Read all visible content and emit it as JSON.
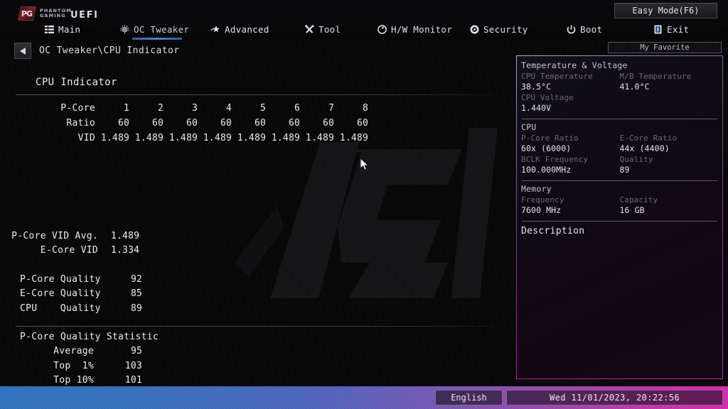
{
  "brand": {
    "badge": "PG",
    "line1": "PHANTOM",
    "line2": "GAMING",
    "uefi": "UEFI"
  },
  "topbar": {
    "easy_mode": "Easy Mode(F6)",
    "tabs": [
      {
        "label": "Main",
        "icon": "list-icon",
        "active": false
      },
      {
        "label": "OC Tweaker",
        "icon": "chip-icon",
        "active": true
      },
      {
        "label": "Advanced",
        "icon": "star-icon",
        "active": false
      },
      {
        "label": "Tool",
        "icon": "tools-icon",
        "active": false
      },
      {
        "label": "H/W Monitor",
        "icon": "gauge-icon",
        "active": false
      },
      {
        "label": "Security",
        "icon": "shield-icon",
        "active": false
      },
      {
        "label": "Boot",
        "icon": "power-icon",
        "active": false
      },
      {
        "label": "Exit",
        "icon": "exit-icon",
        "active": false
      }
    ]
  },
  "breadcrumb": {
    "back_icon": "back-arrow-icon",
    "path": "OC Tweaker\\CPU Indicator",
    "my_favorite": "My Favorite"
  },
  "main": {
    "title": "CPU Indicator",
    "core_table": {
      "row_labels": [
        "P-Core",
        "Ratio",
        "VID"
      ],
      "cores": [
        "1",
        "2",
        "3",
        "4",
        "5",
        "6",
        "7",
        "8"
      ],
      "ratio": [
        "60",
        "60",
        "60",
        "60",
        "60",
        "60",
        "60",
        "60"
      ],
      "vid": [
        "1.489",
        "1.489",
        "1.489",
        "1.489",
        "1.489",
        "1.489",
        "1.489",
        "1.489"
      ]
    },
    "vid_block": [
      {
        "label": "P-Core VID Avg.",
        "value": "1.489"
      },
      {
        "label": "E-Core VID",
        "value": "1.334"
      }
    ],
    "quality_block": [
      {
        "label": "P-Core Quality",
        "value": "92"
      },
      {
        "label": "E-Core Quality",
        "value": "85"
      },
      {
        "label": "CPU    Quality",
        "value": "89"
      }
    ],
    "statistic_block": {
      "heading": "P-Core Quality Statistic",
      "rows": [
        {
          "label": "Average",
          "value": "95"
        },
        {
          "label": "Top  1%",
          "value": "103"
        },
        {
          "label": "Top 10%",
          "value": "101"
        }
      ]
    }
  },
  "sidebar": {
    "sections": [
      {
        "title": "Temperature & Voltage",
        "pairs": [
          {
            "label": "CPU Temperature",
            "value": "38.5°C",
            "label2": "M/B Temperature",
            "value2": "41.0°C"
          },
          {
            "label": "CPU Voltage",
            "value": "1.440V",
            "label2": "",
            "value2": ""
          }
        ]
      },
      {
        "title": "CPU",
        "pairs": [
          {
            "label": "P-Core Ratio",
            "value": "60x (6000)",
            "label2": "E-Core Ratio",
            "value2": "44x (4400)"
          },
          {
            "label": "BCLK Frequency",
            "value": "100.000MHz",
            "label2": "Quality",
            "value2": "89"
          }
        ]
      },
      {
        "title": "Memory",
        "pairs": [
          {
            "label": "Frequency",
            "value": "7600 MHz",
            "label2": "Capacity",
            "value2": "16 GB"
          }
        ]
      }
    ],
    "description_title": "Description"
  },
  "bottombar": {
    "language": "English",
    "datetime": "Wed 11/01/2023, 20:22:56"
  },
  "colors": {
    "accent_blue": "#3a6fbd",
    "accent_magenta": "#cc2fae",
    "tab_active_underline": "#4f7fd0",
    "panel_border": "#b5189e",
    "text_primary": "#eeecf1",
    "text_dim": "#6b6676"
  }
}
